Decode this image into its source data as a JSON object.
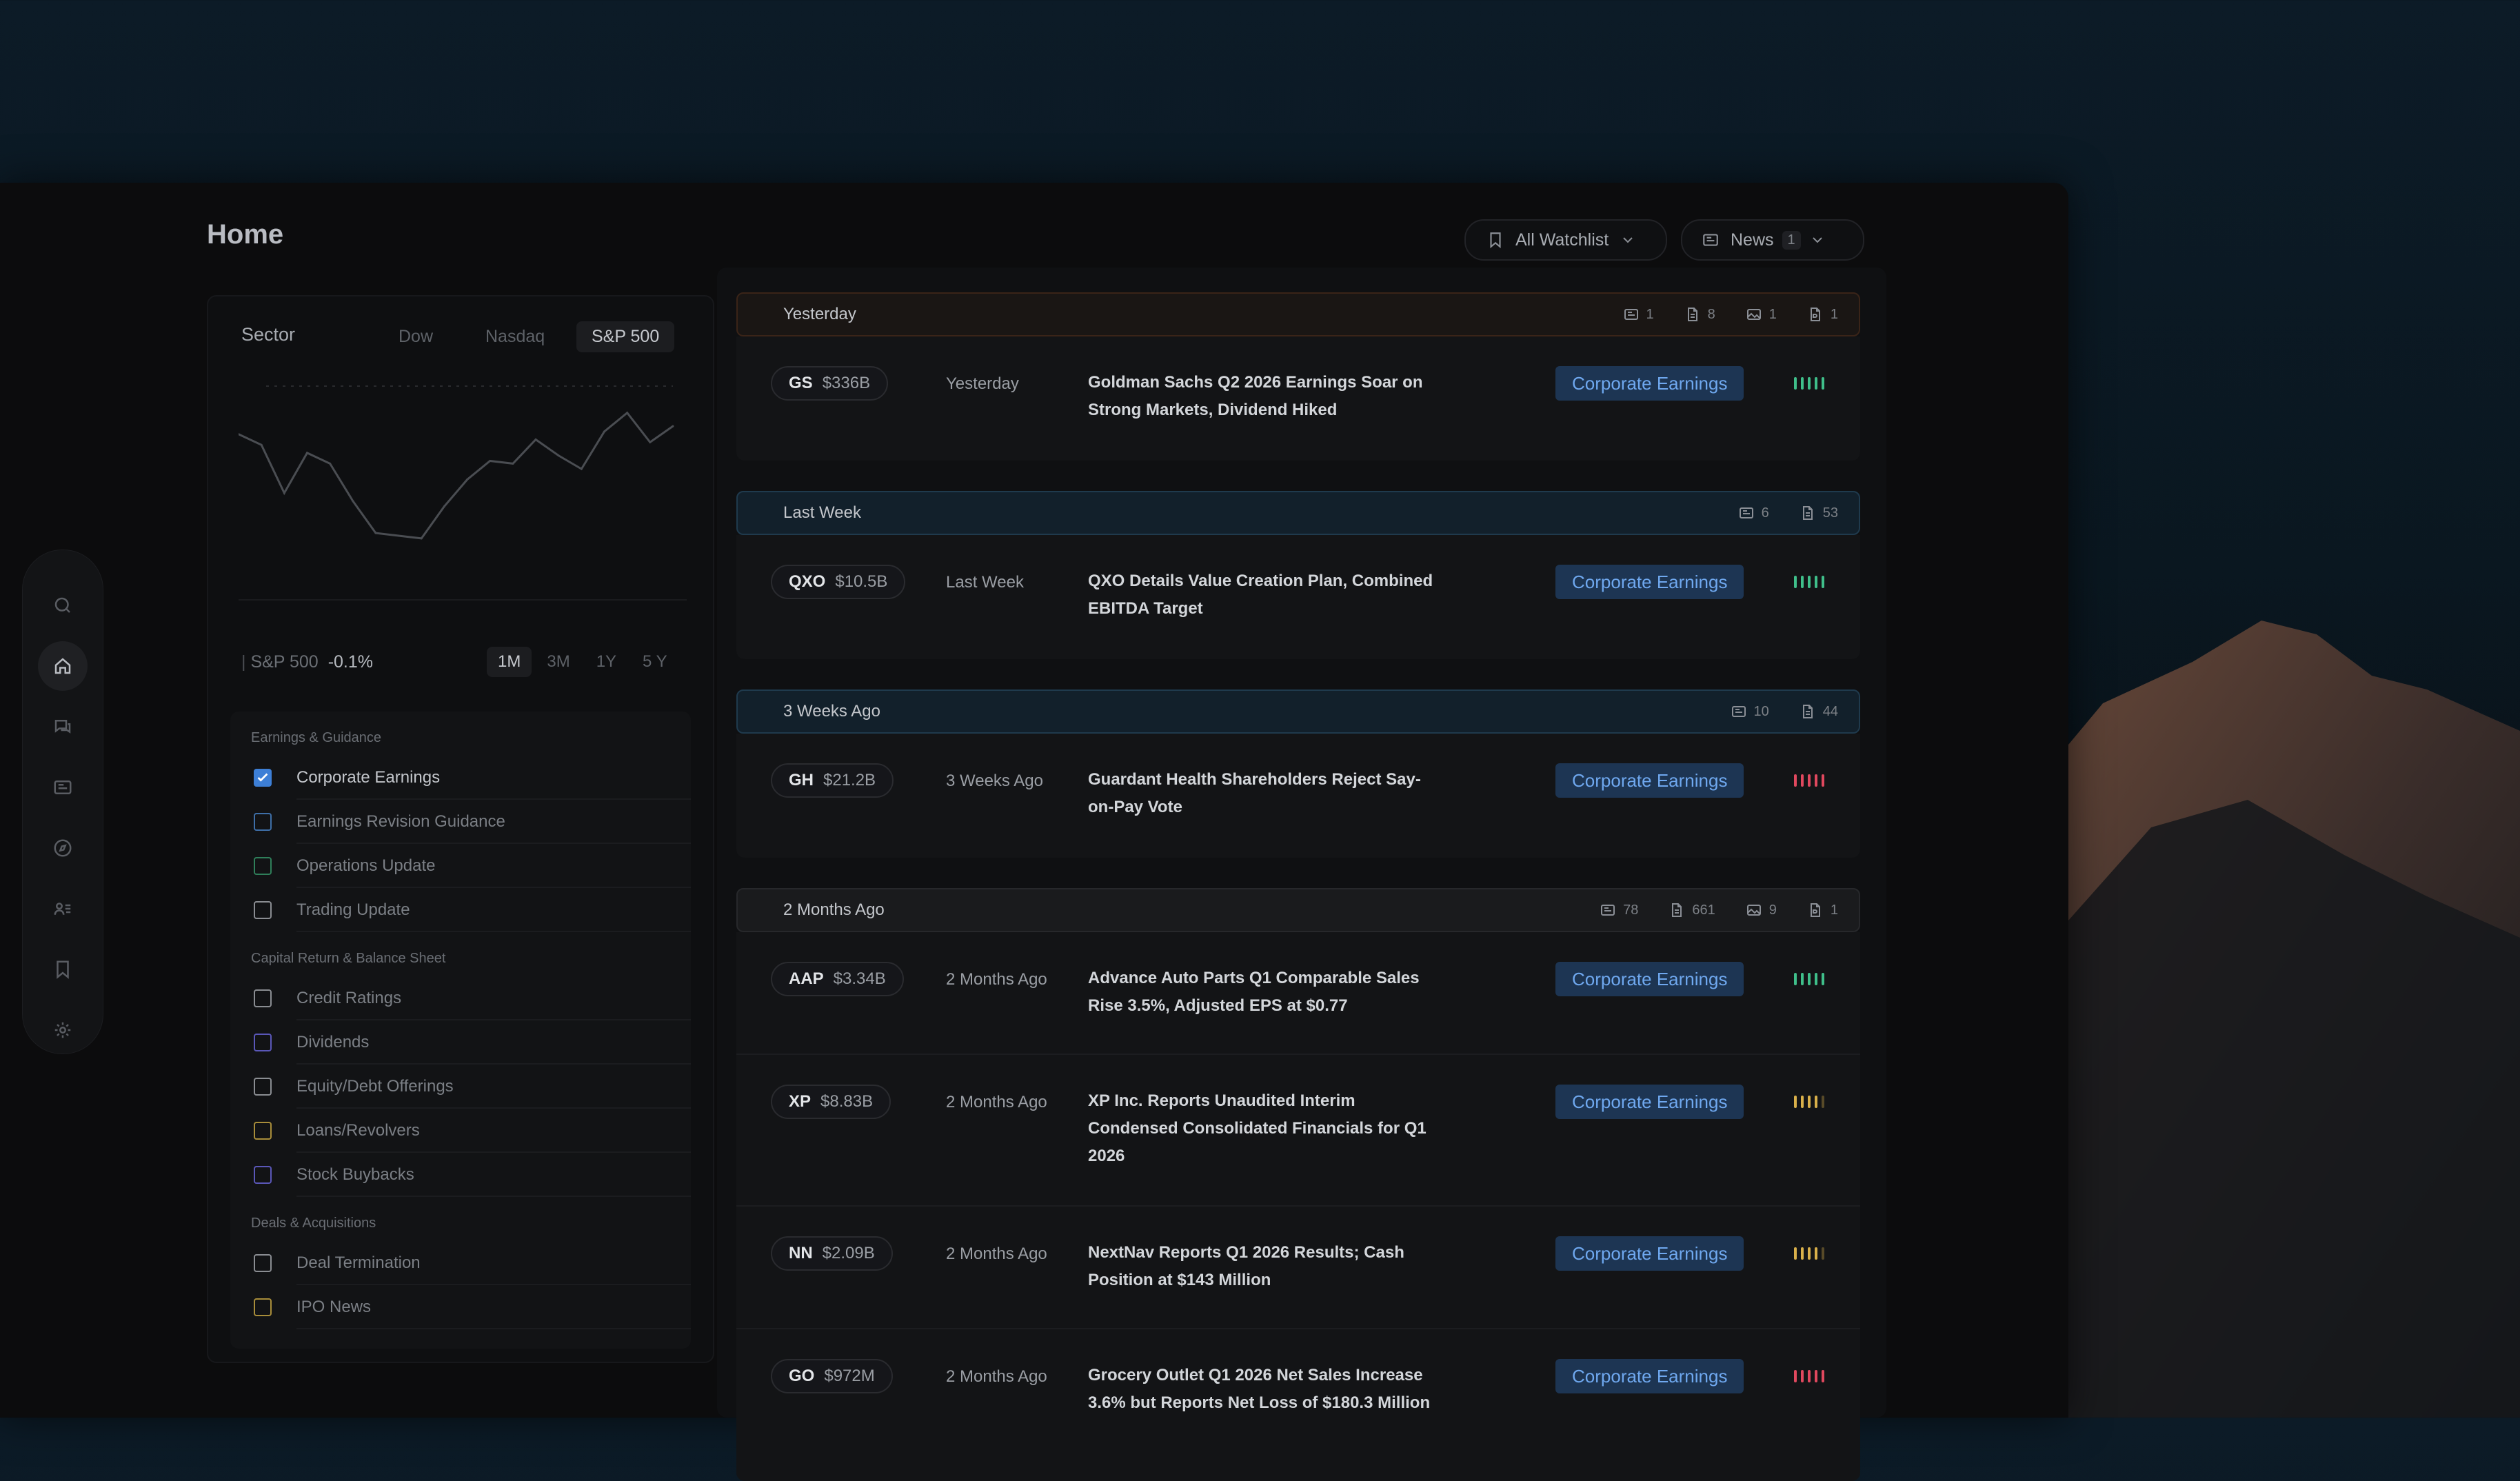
{
  "header": {
    "title": "Home",
    "watchlist_label": "All Watchlist",
    "news_label": "News",
    "news_count": "1"
  },
  "sector_panel": {
    "label": "Sector",
    "index_tabs": [
      "Dow",
      "Nasdaq",
      "S&P 500"
    ],
    "selected_index": "S&P 500",
    "footer_index": "S&P 500",
    "footer_change": "-0.1%",
    "ranges": [
      "1M",
      "3M",
      "1Y",
      "5 Y"
    ],
    "selected_range": "1M"
  },
  "chart_data": {
    "type": "line",
    "title": "",
    "series": [
      {
        "values": [
          62,
          58,
          40,
          55,
          51,
          37,
          25,
          24,
          23,
          35,
          45,
          52,
          51,
          60,
          54,
          49,
          63,
          70,
          59,
          65
        ]
      }
    ],
    "grid": false,
    "colors": {
      "line": "#4a4d52"
    }
  },
  "filters": {
    "groups": [
      {
        "title": "Earnings & Guidance",
        "items": [
          {
            "label": "Corporate Earnings",
            "checked": true,
            "color": "#3d7fd6"
          },
          {
            "label": "Earnings Revision Guidance",
            "checked": false,
            "color": "#3e6fa8"
          },
          {
            "label": "Operations Update",
            "checked": false,
            "color": "#2f7f5a"
          },
          {
            "label": "Trading Update",
            "checked": false,
            "color": "#8a8d92"
          }
        ]
      },
      {
        "title": "Capital Return & Balance Sheet",
        "items": [
          {
            "label": "Credit Ratings",
            "checked": false,
            "color": "#8a8d92"
          },
          {
            "label": "Dividends",
            "checked": false,
            "color": "#5a57b8"
          },
          {
            "label": "Equity/Debt Offerings",
            "checked": false,
            "color": "#8a8d92"
          },
          {
            "label": "Loans/Revolvers",
            "checked": false,
            "color": "#a88d3a"
          },
          {
            "label": "Stock Buybacks",
            "checked": false,
            "color": "#5a57b8"
          }
        ]
      },
      {
        "title": "Deals & Acquisitions",
        "items": [
          {
            "label": "Deal Termination",
            "checked": false,
            "color": "#8a8d92"
          },
          {
            "label": "IPO News",
            "checked": false,
            "color": "#a88d3a"
          }
        ]
      }
    ]
  },
  "news_groups": [
    {
      "label": "Yesterday",
      "style": "yesterday",
      "counts": [
        {
          "icon": "news-icon",
          "value": "1"
        },
        {
          "icon": "document-icon",
          "value": "8"
        },
        {
          "icon": "image-icon",
          "value": "1"
        },
        {
          "icon": "ppt-icon",
          "value": "1"
        }
      ],
      "rows": [
        {
          "ticker": "GS",
          "cap": "$336B",
          "when": "Yesterday",
          "headline": "Goldman Sachs Q2 2026 Earnings Soar on Strong Markets, Dividend Hiked",
          "tag": "Corporate Earnings",
          "sentiment": "positive"
        }
      ]
    },
    {
      "label": "Last Week",
      "style": "blue",
      "counts": [
        {
          "icon": "news-icon",
          "value": "6"
        },
        {
          "icon": "document-icon",
          "value": "53"
        }
      ],
      "rows": [
        {
          "ticker": "QXO",
          "cap": "$10.5B",
          "when": "Last Week",
          "headline": "QXO Details Value Creation Plan, Combined EBITDA Target",
          "tag": "Corporate Earnings",
          "sentiment": "positive"
        }
      ]
    },
    {
      "label": "3 Weeks Ago",
      "style": "blue",
      "counts": [
        {
          "icon": "news-icon",
          "value": "10"
        },
        {
          "icon": "document-icon",
          "value": "44"
        }
      ],
      "rows": [
        {
          "ticker": "GH",
          "cap": "$21.2B",
          "when": "3 Weeks Ago",
          "headline": "Guardant Health Shareholders Reject Say-on-Pay Vote",
          "tag": "Corporate Earnings",
          "sentiment": "negative"
        }
      ]
    },
    {
      "label": "2 Months Ago",
      "style": "gray",
      "counts": [
        {
          "icon": "news-icon",
          "value": "78"
        },
        {
          "icon": "document-icon",
          "value": "661"
        },
        {
          "icon": "image-icon",
          "value": "9"
        },
        {
          "icon": "ppt-icon",
          "value": "1"
        }
      ],
      "rows": [
        {
          "ticker": "AAP",
          "cap": "$3.34B",
          "when": "2 Months Ago",
          "headline": "Advance Auto Parts Q1 Comparable Sales Rise 3.5%, Adjusted EPS at $0.77",
          "tag": "Corporate Earnings",
          "sentiment": "positive"
        },
        {
          "ticker": "XP",
          "cap": "$8.83B",
          "when": "2 Months Ago",
          "headline": "XP Inc. Reports Unaudited Interim Condensed Consolidated Financials for Q1 2026",
          "tag": "Corporate Earnings",
          "sentiment": "neutral"
        },
        {
          "ticker": "NN",
          "cap": "$2.09B",
          "when": "2 Months Ago",
          "headline": "NextNav Reports Q1 2026 Results; Cash Position at $143 Million",
          "tag": "Corporate Earnings",
          "sentiment": "neutral"
        },
        {
          "ticker": "GO",
          "cap": "$972M",
          "when": "2 Months Ago",
          "headline": "Grocery Outlet Q1 2026 Net Sales Increase 3.6% but Reports Net Loss of $180.3 Million",
          "tag": "Corporate Earnings",
          "sentiment": "negative"
        }
      ]
    }
  ],
  "sentiment_colors": {
    "positive": "#3fbf8a",
    "neutral": "#d9b04a",
    "negative": "#e0485e"
  },
  "rail_icons": [
    "search-icon",
    "home-icon",
    "chat-icon",
    "news-icon",
    "compass-icon",
    "users-icon",
    "bookmark-icon",
    "settings-icon"
  ],
  "active_rail": "home-icon"
}
